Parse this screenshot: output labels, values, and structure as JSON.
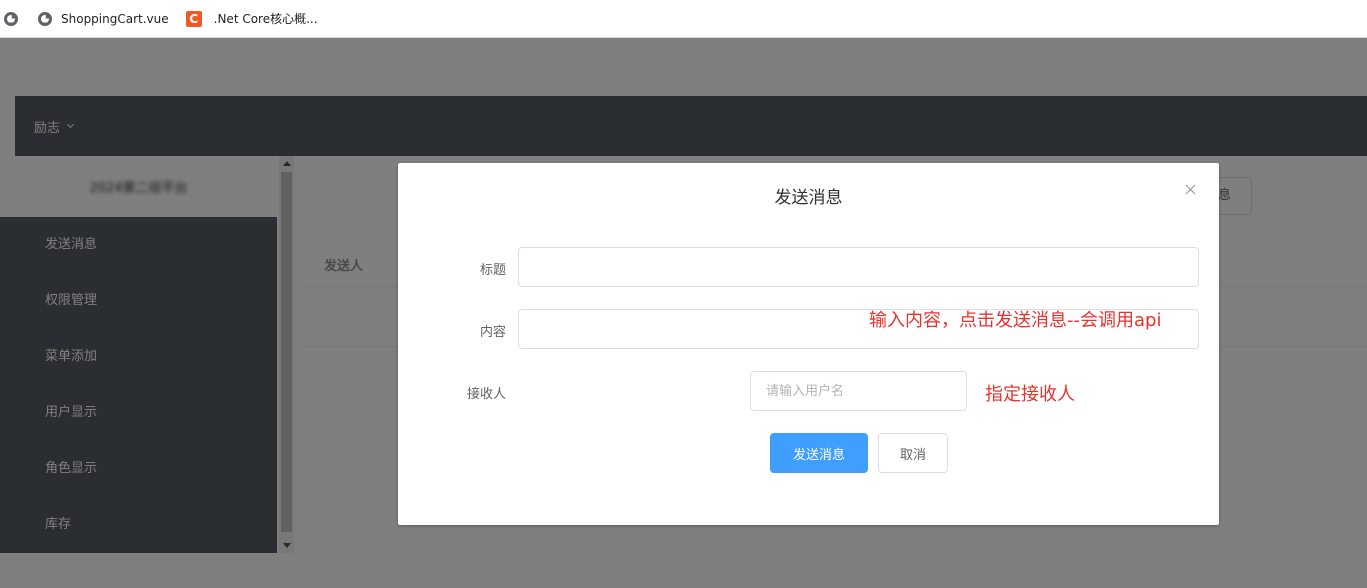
{
  "bookmarks": [
    {
      "label": "",
      "icon": "globe-icon"
    },
    {
      "label": "ShoppingCart.vue",
      "icon": "globe-icon"
    },
    {
      "label": ".Net Core核心概...",
      "icon": "csdn-icon"
    }
  ],
  "nav": {
    "menu_label": "励志"
  },
  "sidebar": {
    "header": "2024第二组平台",
    "items": [
      {
        "label": "发送消息"
      },
      {
        "label": "权限管理"
      },
      {
        "label": "菜单添加"
      },
      {
        "label": "用户显示"
      },
      {
        "label": "角色显示"
      },
      {
        "label": "库存"
      }
    ]
  },
  "table": {
    "col_sender": "发送人"
  },
  "background_button": {
    "label": "息"
  },
  "dialog": {
    "title": "发送消息",
    "fields": {
      "title_label": "标题",
      "title_value": "",
      "content_label": "内容",
      "content_value": "",
      "receiver_label": "接收人",
      "receiver_placeholder": "请输入用户名"
    },
    "send_label": "发送消息",
    "cancel_label": "取消"
  },
  "annotations": {
    "content_note": "输入内容，点击发送消息--会调用api",
    "receiver_note": "指定接收人"
  },
  "colors": {
    "primary": "#409eff",
    "sidebar_bg": "#545c64",
    "annotation": "#e8322e"
  }
}
